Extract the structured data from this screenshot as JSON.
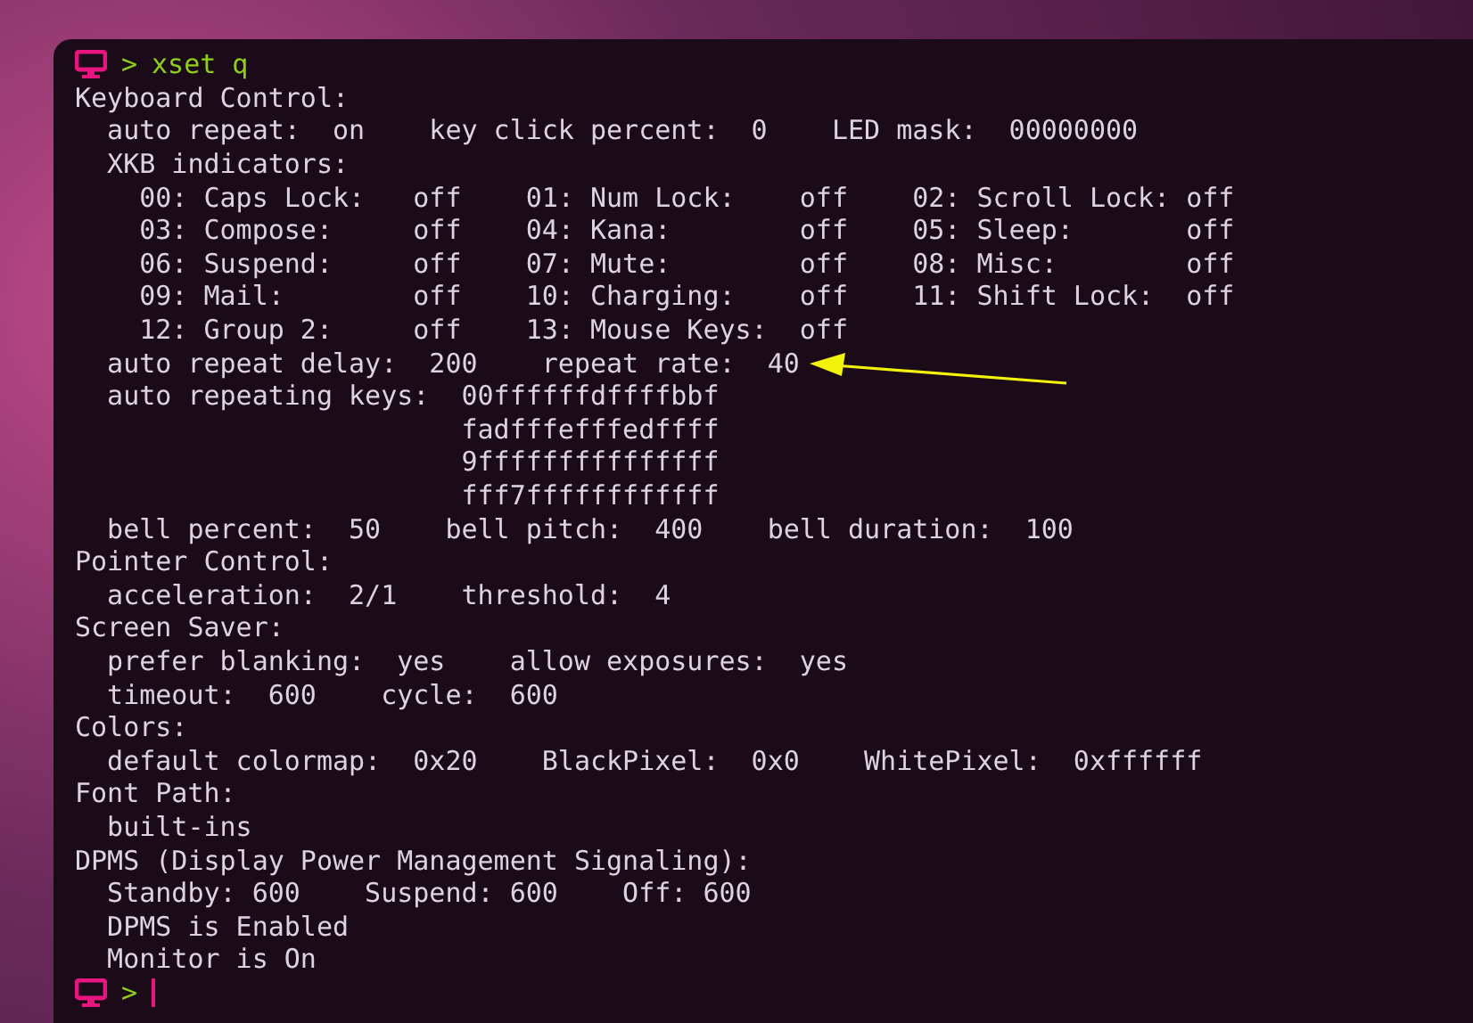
{
  "prompt": {
    "symbol": ">",
    "command": "xset q"
  },
  "output": [
    "Keyboard Control:",
    "  auto repeat:  on    key click percent:  0    LED mask:  00000000",
    "  XKB indicators:",
    "    00: Caps Lock:   off    01: Num Lock:    off    02: Scroll Lock: off",
    "    03: Compose:     off    04: Kana:        off    05: Sleep:       off",
    "    06: Suspend:     off    07: Mute:        off    08: Misc:        off",
    "    09: Mail:        off    10: Charging:    off    11: Shift Lock:  off",
    "    12: Group 2:     off    13: Mouse Keys:  off",
    "  auto repeat delay:  200    repeat rate:  40",
    "  auto repeating keys:  00ffffffdffffbbf",
    "                        fadfffefffedffff",
    "                        9fffffffffffffff",
    "                        fff7ffffffffffff",
    "  bell percent:  50    bell pitch:  400    bell duration:  100",
    "Pointer Control:",
    "  acceleration:  2/1    threshold:  4",
    "Screen Saver:",
    "  prefer blanking:  yes    allow exposures:  yes",
    "  timeout:  600    cycle:  600",
    "Colors:",
    "  default colormap:  0x20    BlackPixel:  0x0    WhitePixel:  0xffffff",
    "Font Path:",
    "  built-ins",
    "DPMS (Display Power Management Signaling):",
    "  Standby: 600    Suspend: 600    Off: 600",
    "  DPMS is Enabled",
    "  Monitor is On"
  ],
  "next_prompt": {
    "symbol": ">"
  }
}
